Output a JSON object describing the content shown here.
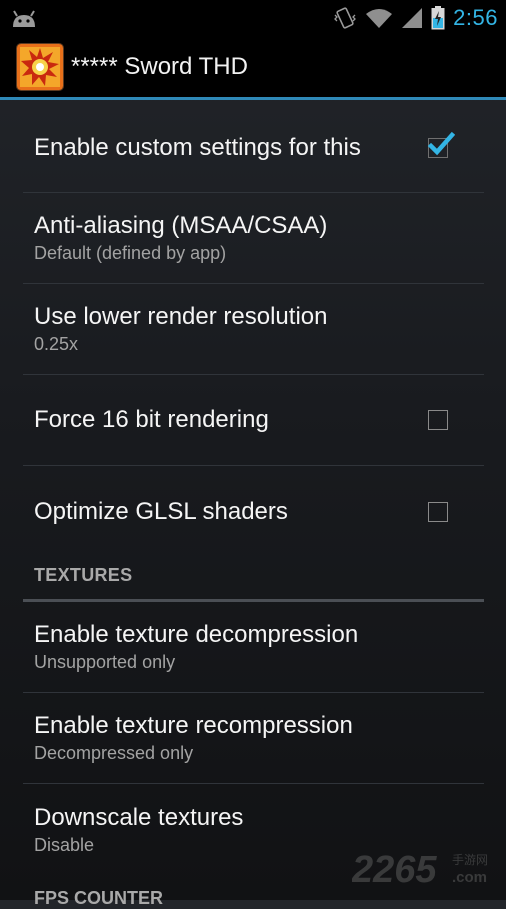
{
  "status_bar": {
    "time": "2:56",
    "icons": [
      "android-icon",
      "vibrate-icon",
      "wifi-icon",
      "signal-icon",
      "battery-charging-icon"
    ]
  },
  "action_bar": {
    "title": "***** Sword THD",
    "icon": "app-icon"
  },
  "colors": {
    "accent": "#33b5e5",
    "divider": "#30343a",
    "section_line": "#4b4f55",
    "summary_text": "#a3a3a3"
  },
  "settings": {
    "custom": {
      "title": "Enable custom settings for this",
      "checked": true
    },
    "msaa": {
      "title": "Anti-aliasing (MSAA/CSAA)",
      "summary": "Default (defined by app)"
    },
    "resolution": {
      "title": "Use lower render resolution",
      "summary": "0.25x"
    },
    "force16": {
      "title": "Force 16 bit rendering",
      "checked": false
    },
    "glsl": {
      "title": "Optimize GLSL shaders",
      "checked": false
    },
    "textures_header": "TEXTURES",
    "decompress": {
      "title": "Enable texture decompression",
      "summary": "Unsupported only"
    },
    "recompress": {
      "title": "Enable texture recompression",
      "summary": "Decompressed only"
    },
    "downscale": {
      "title": "Downscale textures",
      "summary": "Disable"
    },
    "fps_header": "FPS COUNTER"
  },
  "watermark": {
    "brand": "2265",
    "sub": "手游网",
    "suffix": ".com"
  }
}
